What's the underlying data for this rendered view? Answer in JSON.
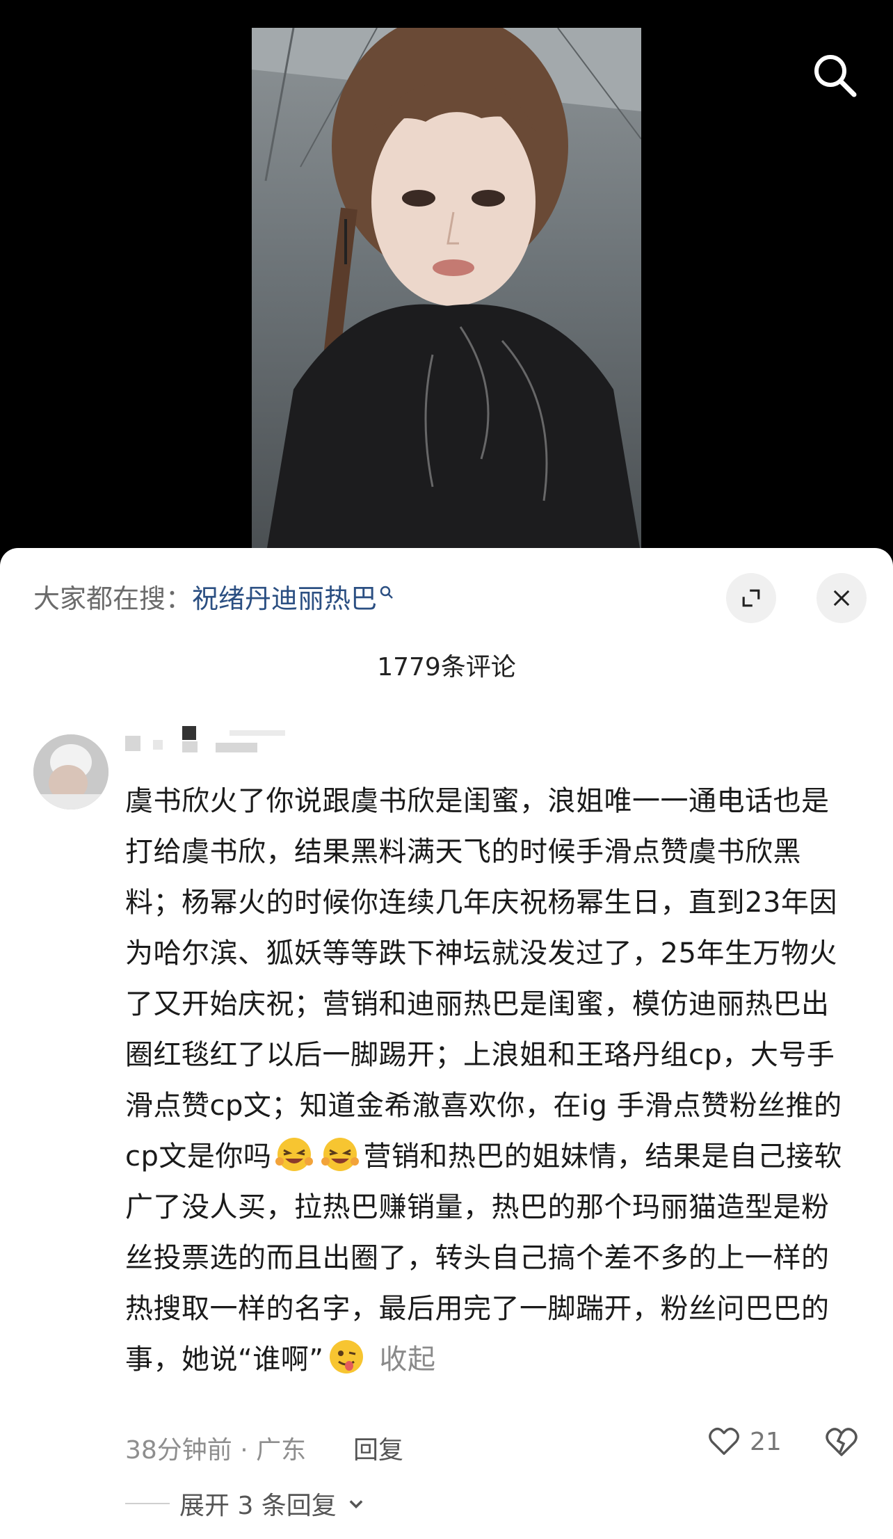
{
  "video": {
    "search_icon": "search-icon",
    "image_desc": "portrait-photo"
  },
  "sheet": {
    "hot_search_prefix": "大家都在搜：",
    "hot_search_term": "祝绪丹迪丽热巴",
    "comment_count_label": "1779条评论",
    "expand_icon": "expand-icon",
    "close_icon": "close-icon"
  },
  "comment": {
    "text_part1": "虞书欣火了你说跟虞书欣是闺蜜，浪姐唯一一通电话也是打给虞书欣，结果黑料满天飞的时候手滑点赞虞书欣黑料；杨幂火的时候你连续几年庆祝杨幂生日，直到23年因为哈尔滨、狐妖等等跌下神坛就没发过了，25年生万物火了又开始庆祝；营销和迪丽热巴是闺蜜，模仿迪丽热巴出圈红毯红了以后一脚踢开；上浪姐和王珞丹组cp，大号手滑点赞cp文；知道金希澈喜欢你，在ig 手滑点赞粉丝推的cp文是你吗",
    "text_part2": "营销和热巴的姐妹情，结果是自己接软广了没人买，拉热巴赚销量，热巴的那个玛丽猫造型是粉丝投票选的而且出圈了，转头自己搞个差不多的上一样的热搜取一样的名字，最后用完了一脚踹开，粉丝问巴巴的事，她说“谁啊”",
    "collapse_label": "收起",
    "time_location": "38分钟前 · 广东",
    "reply_label": "回复",
    "like_count": "21",
    "expand_replies_label": "展开 3 条回复"
  }
}
